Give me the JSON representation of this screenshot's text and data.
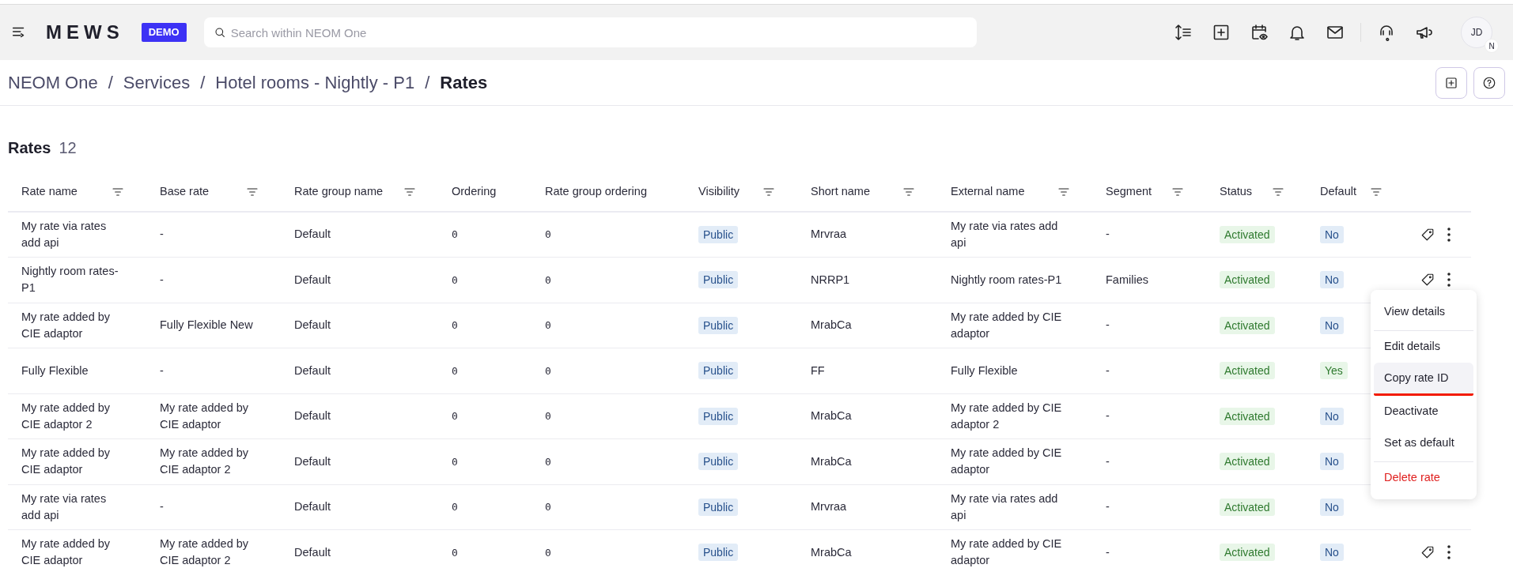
{
  "topbar": {
    "logo": "MEWS",
    "environment_badge": "DEMO",
    "search": {
      "placeholder": "Search within NEOM One"
    },
    "avatar": {
      "initials": "JD",
      "badge": "N"
    }
  },
  "breadcrumb": [
    {
      "label": "NEOM One",
      "current": false
    },
    {
      "separator": "/",
      "label": "Services",
      "current": false
    },
    {
      "separator": "/",
      "label": "Hotel rooms - Nightly - P1",
      "current": false
    },
    {
      "separator": "/",
      "label": "Rates",
      "current": true
    }
  ],
  "section": {
    "title": "Rates",
    "count": "12"
  },
  "table": {
    "columns": [
      {
        "label": "Rate name",
        "filter": true
      },
      {
        "label": "Base rate",
        "filter": true
      },
      {
        "label": "Rate group name",
        "filter": true
      },
      {
        "label": "Ordering",
        "filter": false
      },
      {
        "label": "Rate group ordering",
        "filter": false
      },
      {
        "label": "Visibility",
        "filter": true
      },
      {
        "label": "Short name",
        "filter": true
      },
      {
        "label": "External name",
        "filter": true
      },
      {
        "label": "Segment",
        "filter": true
      },
      {
        "label": "Status",
        "filter": true
      },
      {
        "label": "Default",
        "filter": true
      }
    ],
    "rows": [
      {
        "rate_name": "My rate via rates add api",
        "base_rate": "-",
        "rate_group_name": "Default",
        "ordering": "0",
        "rate_group_ordering": "0",
        "visibility": "Public",
        "short_name": "Mrvraa",
        "external_name": "My rate via rates add api",
        "segment": "-",
        "status": "Activated",
        "default": "No",
        "default_on": false,
        "actions_visible": true
      },
      {
        "rate_name": "Nightly room rates-P1",
        "base_rate": "-",
        "rate_group_name": "Default",
        "ordering": "0",
        "rate_group_ordering": "0",
        "visibility": "Public",
        "short_name": "NRRP1",
        "external_name": "Nightly room rates-P1",
        "segment": "Families",
        "status": "Activated",
        "default": "No",
        "default_on": false,
        "actions_visible": true
      },
      {
        "rate_name": "My rate added by CIE adaptor",
        "base_rate": "Fully Flexible New",
        "rate_group_name": "Default",
        "ordering": "0",
        "rate_group_ordering": "0",
        "visibility": "Public",
        "short_name": "MrabCa",
        "external_name": "My rate added by CIE adaptor",
        "segment": "-",
        "status": "Activated",
        "default": "No",
        "default_on": false
      },
      {
        "rate_name": "Fully Flexible",
        "base_rate": "-",
        "rate_group_name": "Default",
        "ordering": "0",
        "rate_group_ordering": "0",
        "visibility": "Public",
        "short_name": "FF",
        "external_name": "Fully Flexible",
        "segment": "-",
        "status": "Activated",
        "default": "Yes",
        "default_on": true,
        "actions_visible": false
      },
      {
        "rate_name": "My rate added by CIE adaptor 2",
        "base_rate": "My rate added by CIE adaptor",
        "rate_group_name": "Default",
        "ordering": "0",
        "rate_group_ordering": "0",
        "visibility": "Public",
        "short_name": "MrabCa",
        "external_name": "My rate added by CIE adaptor 2",
        "segment": "-",
        "status": "Activated",
        "default": "No",
        "default_on": false
      },
      {
        "rate_name": "My rate added by CIE adaptor",
        "base_rate": "My rate added by CIE adaptor 2",
        "rate_group_name": "Default",
        "ordering": "0",
        "rate_group_ordering": "0",
        "visibility": "Public",
        "short_name": "MrabCa",
        "external_name": "My rate added by CIE adaptor",
        "segment": "-",
        "status": "Activated",
        "default": "No",
        "default_on": false
      },
      {
        "rate_name": "My rate via rates add api",
        "base_rate": "-",
        "rate_group_name": "Default",
        "ordering": "0",
        "rate_group_ordering": "0",
        "visibility": "Public",
        "short_name": "Mrvraa",
        "external_name": "My rate via rates add api",
        "segment": "-",
        "status": "Activated",
        "default": "No",
        "default_on": false,
        "actions_visible": false
      },
      {
        "rate_name": "My rate added by CIE adaptor",
        "base_rate": "My rate added by CIE adaptor 2",
        "rate_group_name": "Default",
        "ordering": "0",
        "rate_group_ordering": "0",
        "visibility": "Public",
        "short_name": "MrabCa",
        "external_name": "My rate added by CIE adaptor",
        "segment": "-",
        "status": "Activated",
        "default": "No",
        "default_on": false,
        "actions_visible": true
      }
    ]
  },
  "row_menu": {
    "items": [
      {
        "label": "View details",
        "kind": "normal",
        "separator_before": false,
        "highlighted": false,
        "underlined": false
      },
      {
        "label": "Edit details",
        "kind": "normal",
        "separator_before": true,
        "highlighted": false,
        "underlined": false
      },
      {
        "label": "Copy rate ID",
        "kind": "normal",
        "separator_before": false,
        "highlighted": true,
        "underlined": true
      },
      {
        "label": "Deactivate",
        "kind": "normal",
        "separator_before": false,
        "highlighted": false,
        "underlined": false
      },
      {
        "label": "Set as default",
        "kind": "normal",
        "separator_before": false,
        "highlighted": false,
        "underlined": false
      },
      {
        "label": "Delete rate",
        "kind": "danger",
        "separator_before": true,
        "highlighted": false,
        "underlined": false
      }
    ]
  }
}
